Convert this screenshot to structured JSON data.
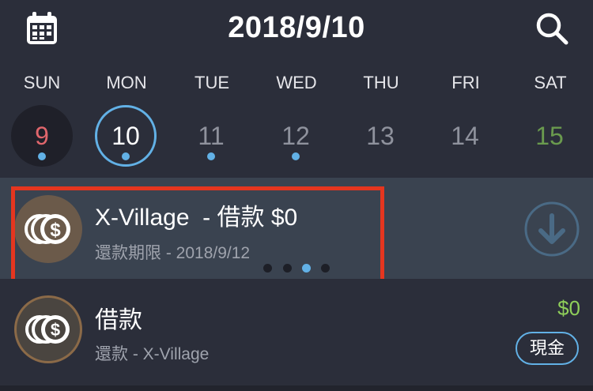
{
  "header": {
    "title": "2018/9/10",
    "calendar_icon": "calendar-icon",
    "search_icon": "search-icon"
  },
  "weekdays": [
    "SUN",
    "MON",
    "TUE",
    "WED",
    "THU",
    "FRI",
    "SAT"
  ],
  "days": [
    {
      "num": "9",
      "has_event": true
    },
    {
      "num": "10",
      "has_event": true,
      "selected": true
    },
    {
      "num": "11",
      "has_event": true
    },
    {
      "num": "12",
      "has_event": true
    },
    {
      "num": "13",
      "has_event": false
    },
    {
      "num": "14",
      "has_event": false
    },
    {
      "num": "15",
      "has_event": false
    }
  ],
  "items": [
    {
      "title": "X-Village  - 借款 $0",
      "subtitle": "還款期限 - 2018/9/12",
      "icon": "coins-icon",
      "action_icon": "download-icon",
      "pager_active": 3,
      "pager_total": 4
    },
    {
      "title": "借款",
      "subtitle": "還款 - X-Village",
      "icon": "coins-icon",
      "amount": "$0",
      "badge": "現金"
    }
  ],
  "colors": {
    "background": "#2b2e3a",
    "accent": "#62b1e6",
    "sunday": "#e0666c",
    "saturday": "#6a9a4e",
    "amount": "#8fcf5a",
    "highlight": "#e5361f"
  }
}
